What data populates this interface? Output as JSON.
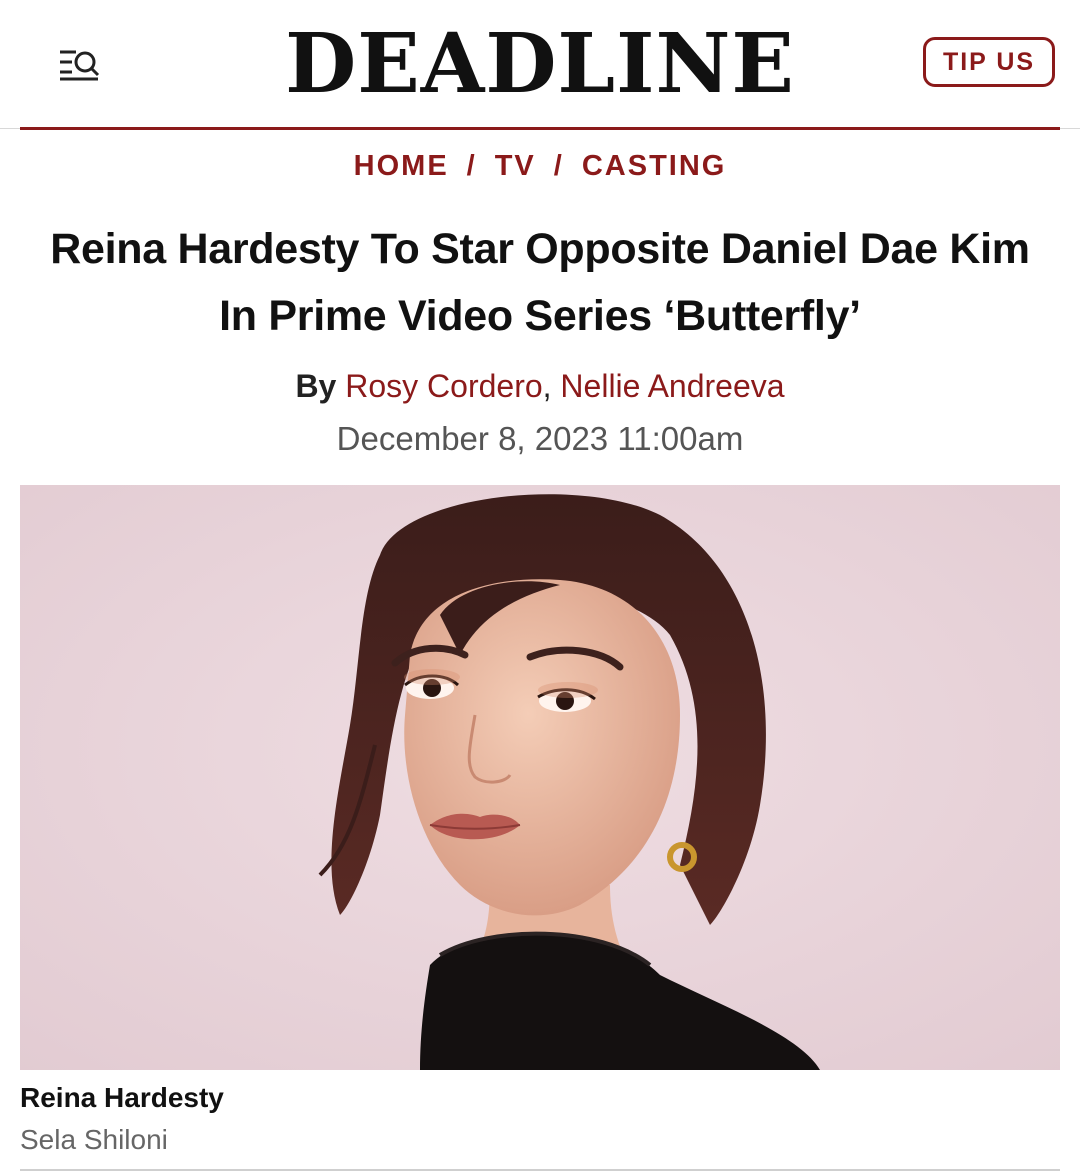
{
  "header": {
    "logo": "DEADLINE",
    "tip_button": "TIP US",
    "menu_icon": "menu-search-icon"
  },
  "breadcrumb": {
    "items": [
      "HOME",
      "TV",
      "CASTING"
    ],
    "separator": "/"
  },
  "article": {
    "headline": "Reina Hardesty To Star Opposite Daniel Dae Kim In Prime Video Series ‘Butterfly’",
    "byline": {
      "prefix": "By",
      "authors": [
        "Rosy Cordero",
        "Nellie Andreeva"
      ],
      "joiner": ","
    },
    "date": "December 8, 2023 11:00am",
    "image": {
      "caption_name": "Reina Hardesty",
      "caption_credit": "Sela Shiloni"
    }
  },
  "colors": {
    "brand_red": "#8b1a1a",
    "hero_background": "#e8d4da"
  }
}
